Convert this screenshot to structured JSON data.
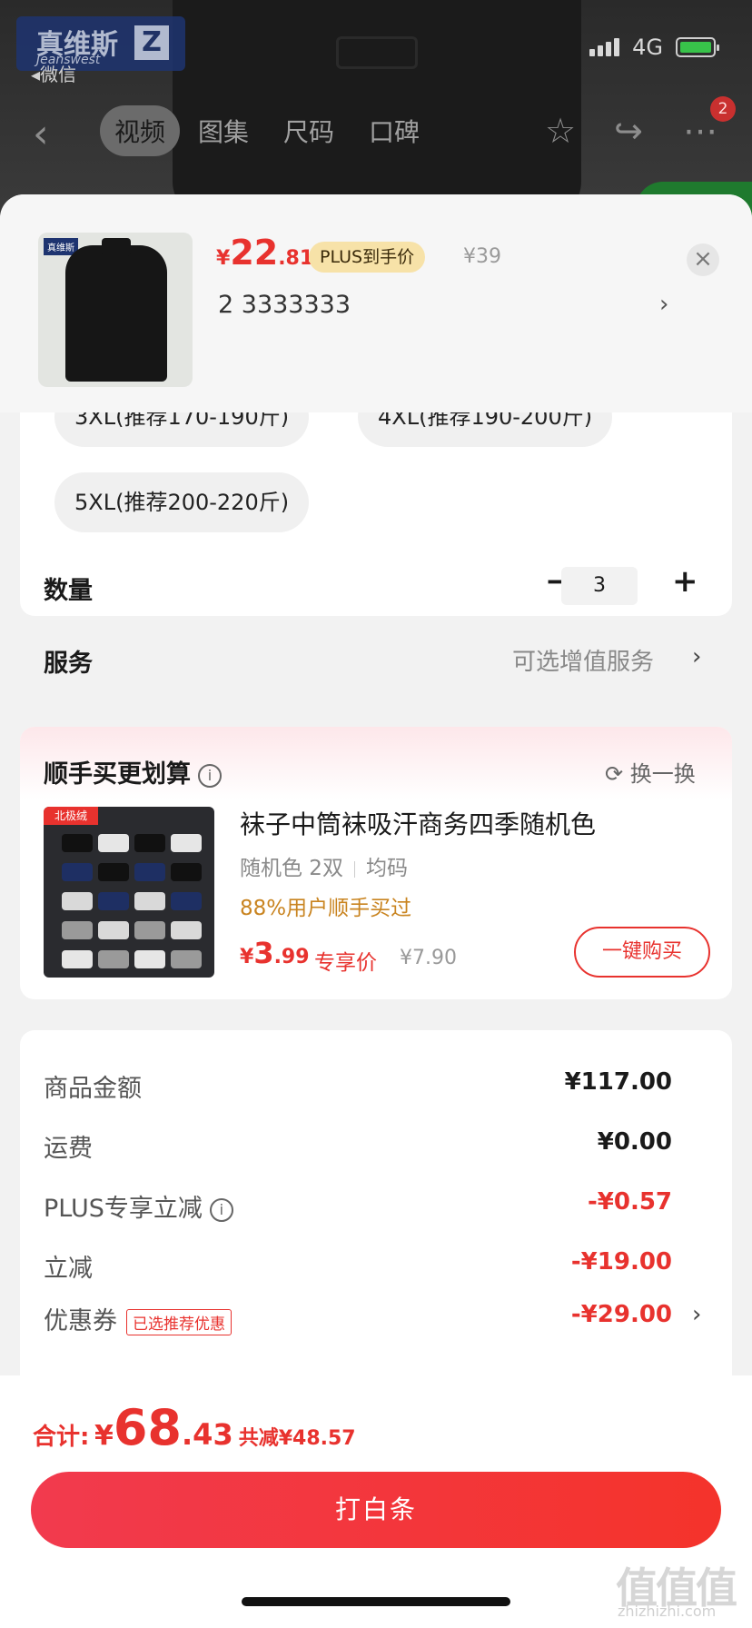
{
  "status_bar": {
    "network": "4G"
  },
  "brand": {
    "name_cn": "真维斯",
    "name_en": "Jeanswest",
    "mark": "Z",
    "back_to": "微信"
  },
  "nav": {
    "tabs": [
      {
        "label": "视频",
        "active": true
      },
      {
        "label": "图集",
        "active": false
      },
      {
        "label": "尺码",
        "active": false
      },
      {
        "label": "口碑",
        "active": false
      }
    ],
    "icons": [
      "back-arrow-icon",
      "star-icon",
      "share-icon",
      "more-icon"
    ],
    "more_badge": "2"
  },
  "sku_header": {
    "thumb_tag": "真维斯",
    "price_symbol": "¥",
    "price_int": "22",
    "price_dec": ".81",
    "plus_label": "PLUS到手价",
    "original_price": "¥39",
    "selection": "2  3333333",
    "arrow": "›",
    "close": "×"
  },
  "sizes": [
    "3XL(推荐170-190斤)",
    "4XL(推荐190-200斤)",
    "5XL(推荐200-220斤)"
  ],
  "quantity": {
    "label": "数量",
    "value": "3",
    "minus": "−",
    "plus": "+"
  },
  "service": {
    "label": "服务",
    "value": "可选增值服务",
    "arrow": "›"
  },
  "bundle": {
    "title": "顺手买更划算",
    "info": "i",
    "refresh_label": "换一换",
    "product": {
      "brand_tag": "北极绒",
      "title": "袜子中筒袜吸汗商务四季随机色",
      "spec_color": "随机色 2双",
      "spec_size": "均码",
      "users": "88%用户顺手买过",
      "price_symbol": "¥",
      "price_int": "3",
      "price_dec": ".99",
      "exclusive": "专享价",
      "original_price": "¥7.90",
      "buy_label": "一键购买"
    }
  },
  "fees": [
    {
      "label": "商品金额",
      "value": "¥117.00",
      "red": false
    },
    {
      "label": "运费",
      "value": "¥0.00",
      "red": false
    },
    {
      "label": "PLUS专享立减",
      "value": "-¥0.57",
      "red": true
    },
    {
      "label": "立减",
      "value": "-¥19.00",
      "red": true
    },
    {
      "label": "优惠券",
      "tag": "已选推荐优惠",
      "value": "-¥29.00",
      "red": true
    }
  ],
  "footer": {
    "total_label": "合计:",
    "total_symbol": "¥",
    "total_int": "68",
    "total_dec": ".43",
    "saved": "共减¥48.57",
    "pay_label": "打白条"
  },
  "watermark": {
    "main": "值值值",
    "sub": "zhizhizhi.com"
  },
  "colors": {
    "accent": "#e8322e",
    "plus_pill": "#f7e2a8",
    "pay_button": "#f23a4e",
    "users_text": "#c98420"
  }
}
